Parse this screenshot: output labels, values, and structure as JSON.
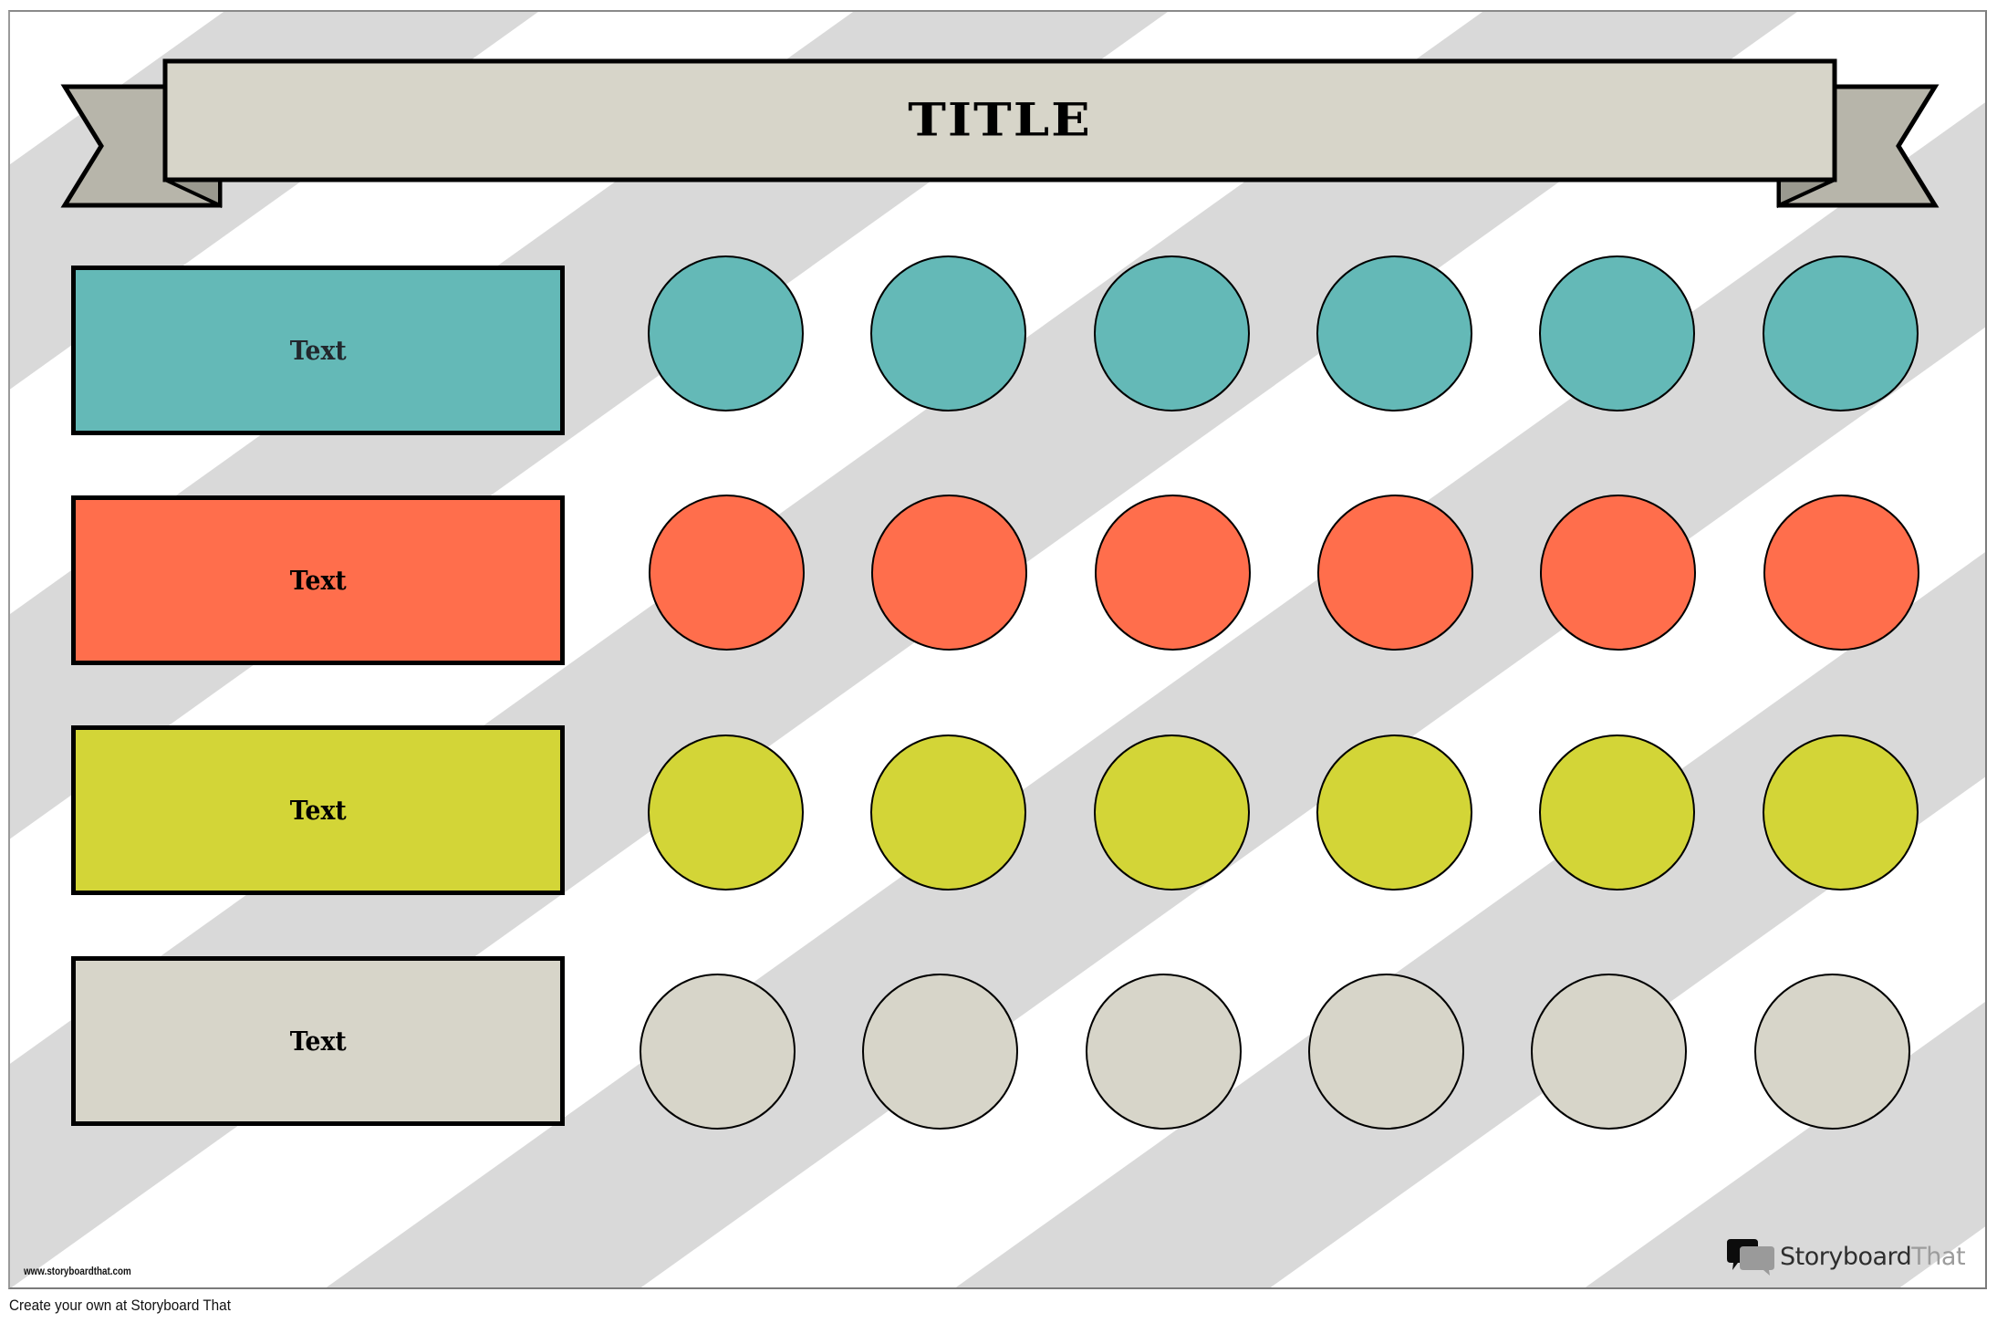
{
  "poster": {
    "title": "TITLE",
    "colors": {
      "stripe": "#d9d9d9",
      "banner_main": "#d7d5c9",
      "banner_tail": "#b7b5aa",
      "banner_fold": "#9a998f",
      "outline": "#000000",
      "card_border": "#7b7b7b"
    },
    "rows": [
      {
        "label": "Text",
        "color": "#64b9b7",
        "text_color": "#22272c",
        "circles": 6
      },
      {
        "label": "Text",
        "color": "#ff6e4c",
        "text_color": "#000000",
        "circles": 6
      },
      {
        "label": "Text",
        "color": "#d3d537",
        "text_color": "#000000",
        "circles": 6
      },
      {
        "label": "Text",
        "color": "#d7d5c9",
        "text_color": "#000000",
        "circles": 6
      }
    ]
  },
  "watermark": "www.storyboardthat.com",
  "footer": "Create your own at Storyboard That",
  "logo": {
    "part1": "Storyboard",
    "part2": "That",
    "icon": "speech-bubbles-icon"
  }
}
